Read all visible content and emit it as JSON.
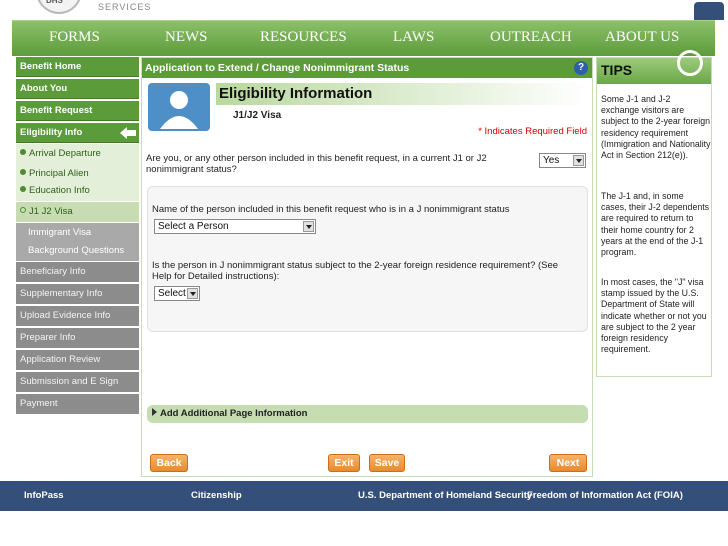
{
  "banner": {
    "text": "SERVICES"
  },
  "nav": [
    "FORMS",
    "NEWS",
    "RESOURCES",
    "LAWS",
    "OUTREACH",
    "ABOUT US"
  ],
  "sidebar": {
    "items": [
      {
        "label": "Benefit Home"
      },
      {
        "label": "About You"
      },
      {
        "label": "Benefit Request"
      },
      {
        "label": "Eligibility Info"
      },
      {
        "label": "Arrival Departure"
      },
      {
        "label": "Principal Alien"
      },
      {
        "label": "Education Info"
      },
      {
        "label": "J1 J2 Visa"
      },
      {
        "label": "Immigrant Visa"
      },
      {
        "label": "Background Questions"
      },
      {
        "label": "Beneficiary Info"
      },
      {
        "label": "Supplementary Info"
      },
      {
        "label": "Upload Evidence Info"
      },
      {
        "label": "Preparer Info"
      },
      {
        "label": "Application Review"
      },
      {
        "label": "Submission and E Sign"
      },
      {
        "label": "Payment"
      }
    ]
  },
  "main": {
    "header": "Application to Extend / Change Nonimmigrant Status",
    "help": "?",
    "title": "Eligibility Information",
    "subtitle": "J1/J2 Visa",
    "required_note": "* Indicates Required Field",
    "q1": "Are you, or any other person included in this benefit request, in a current J1 or J2 nonimmigrant status?",
    "q1_value": "Yes",
    "q2": "Name of the person included in this benefit request who is in a J nonimmigrant status",
    "q2_value": "Select a Person",
    "q3": "Is the person in J nonimmigrant status subject to the 2-year foreign residence requirement? (See Help for Detailed instructions):",
    "q3_value": "Select",
    "add_info": "Add Additional Page Information",
    "buttons": {
      "back": "Back",
      "exit": "Exit",
      "save": "Save",
      "next": "Next"
    }
  },
  "tips": {
    "title": "TIPS",
    "paragraphs": [
      "Some J-1 and J-2 exchange visitors are subject to the 2-year foreign residency requirement (Immigration and Nationality Act in Section 212(e)).",
      "The J-1 and, in some cases, their J-2 dependents are required to return to their home country for 2 years at the end of the J-1 program.",
      "In most cases, the \"J\" visa stamp issued by the U.S. Department of State will indicate whether or not you are subject to the 2 year foreign residency requirement."
    ]
  },
  "footer": [
    "InfoPass",
    "Citizenship",
    "U.S. Department of Homeland Security",
    "Freedom of Information Act (FOIA)"
  ],
  "colors": {
    "nav_green": "#5d9b3b",
    "footer_blue": "#34507a",
    "button_orange": "#e88a2d",
    "required_red": "#d40000"
  }
}
